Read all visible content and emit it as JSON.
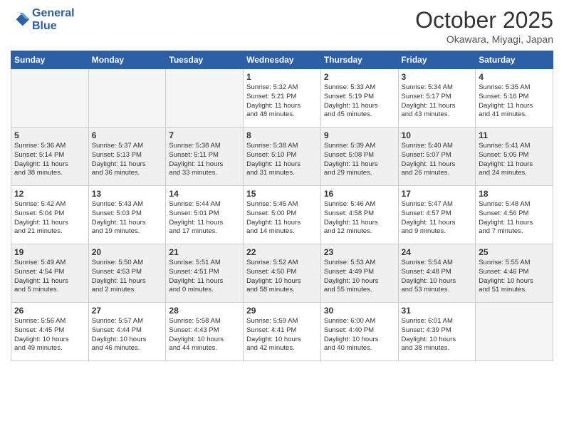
{
  "header": {
    "logo_line1": "General",
    "logo_line2": "Blue",
    "month": "October 2025",
    "location": "Okawara, Miyagi, Japan"
  },
  "weekdays": [
    "Sunday",
    "Monday",
    "Tuesday",
    "Wednesday",
    "Thursday",
    "Friday",
    "Saturday"
  ],
  "weeks": [
    [
      {
        "day": "",
        "info": ""
      },
      {
        "day": "",
        "info": ""
      },
      {
        "day": "",
        "info": ""
      },
      {
        "day": "1",
        "info": "Sunrise: 5:32 AM\nSunset: 5:21 PM\nDaylight: 11 hours\nand 48 minutes."
      },
      {
        "day": "2",
        "info": "Sunrise: 5:33 AM\nSunset: 5:19 PM\nDaylight: 11 hours\nand 45 minutes."
      },
      {
        "day": "3",
        "info": "Sunrise: 5:34 AM\nSunset: 5:17 PM\nDaylight: 11 hours\nand 43 minutes."
      },
      {
        "day": "4",
        "info": "Sunrise: 5:35 AM\nSunset: 5:16 PM\nDaylight: 11 hours\nand 41 minutes."
      }
    ],
    [
      {
        "day": "5",
        "info": "Sunrise: 5:36 AM\nSunset: 5:14 PM\nDaylight: 11 hours\nand 38 minutes."
      },
      {
        "day": "6",
        "info": "Sunrise: 5:37 AM\nSunset: 5:13 PM\nDaylight: 11 hours\nand 36 minutes."
      },
      {
        "day": "7",
        "info": "Sunrise: 5:38 AM\nSunset: 5:11 PM\nDaylight: 11 hours\nand 33 minutes."
      },
      {
        "day": "8",
        "info": "Sunrise: 5:38 AM\nSunset: 5:10 PM\nDaylight: 11 hours\nand 31 minutes."
      },
      {
        "day": "9",
        "info": "Sunrise: 5:39 AM\nSunset: 5:08 PM\nDaylight: 11 hours\nand 29 minutes."
      },
      {
        "day": "10",
        "info": "Sunrise: 5:40 AM\nSunset: 5:07 PM\nDaylight: 11 hours\nand 26 minutes."
      },
      {
        "day": "11",
        "info": "Sunrise: 5:41 AM\nSunset: 5:05 PM\nDaylight: 11 hours\nand 24 minutes."
      }
    ],
    [
      {
        "day": "12",
        "info": "Sunrise: 5:42 AM\nSunset: 5:04 PM\nDaylight: 11 hours\nand 21 minutes."
      },
      {
        "day": "13",
        "info": "Sunrise: 5:43 AM\nSunset: 5:03 PM\nDaylight: 11 hours\nand 19 minutes."
      },
      {
        "day": "14",
        "info": "Sunrise: 5:44 AM\nSunset: 5:01 PM\nDaylight: 11 hours\nand 17 minutes."
      },
      {
        "day": "15",
        "info": "Sunrise: 5:45 AM\nSunset: 5:00 PM\nDaylight: 11 hours\nand 14 minutes."
      },
      {
        "day": "16",
        "info": "Sunrise: 5:46 AM\nSunset: 4:58 PM\nDaylight: 11 hours\nand 12 minutes."
      },
      {
        "day": "17",
        "info": "Sunrise: 5:47 AM\nSunset: 4:57 PM\nDaylight: 11 hours\nand 9 minutes."
      },
      {
        "day": "18",
        "info": "Sunrise: 5:48 AM\nSunset: 4:56 PM\nDaylight: 11 hours\nand 7 minutes."
      }
    ],
    [
      {
        "day": "19",
        "info": "Sunrise: 5:49 AM\nSunset: 4:54 PM\nDaylight: 11 hours\nand 5 minutes."
      },
      {
        "day": "20",
        "info": "Sunrise: 5:50 AM\nSunset: 4:53 PM\nDaylight: 11 hours\nand 2 minutes."
      },
      {
        "day": "21",
        "info": "Sunrise: 5:51 AM\nSunset: 4:51 PM\nDaylight: 11 hours\nand 0 minutes."
      },
      {
        "day": "22",
        "info": "Sunrise: 5:52 AM\nSunset: 4:50 PM\nDaylight: 10 hours\nand 58 minutes."
      },
      {
        "day": "23",
        "info": "Sunrise: 5:53 AM\nSunset: 4:49 PM\nDaylight: 10 hours\nand 55 minutes."
      },
      {
        "day": "24",
        "info": "Sunrise: 5:54 AM\nSunset: 4:48 PM\nDaylight: 10 hours\nand 53 minutes."
      },
      {
        "day": "25",
        "info": "Sunrise: 5:55 AM\nSunset: 4:46 PM\nDaylight: 10 hours\nand 51 minutes."
      }
    ],
    [
      {
        "day": "26",
        "info": "Sunrise: 5:56 AM\nSunset: 4:45 PM\nDaylight: 10 hours\nand 49 minutes."
      },
      {
        "day": "27",
        "info": "Sunrise: 5:57 AM\nSunset: 4:44 PM\nDaylight: 10 hours\nand 46 minutes."
      },
      {
        "day": "28",
        "info": "Sunrise: 5:58 AM\nSunset: 4:43 PM\nDaylight: 10 hours\nand 44 minutes."
      },
      {
        "day": "29",
        "info": "Sunrise: 5:59 AM\nSunset: 4:41 PM\nDaylight: 10 hours\nand 42 minutes."
      },
      {
        "day": "30",
        "info": "Sunrise: 6:00 AM\nSunset: 4:40 PM\nDaylight: 10 hours\nand 40 minutes."
      },
      {
        "day": "31",
        "info": "Sunrise: 6:01 AM\nSunset: 4:39 PM\nDaylight: 10 hours\nand 38 minutes."
      },
      {
        "day": "",
        "info": ""
      }
    ]
  ]
}
